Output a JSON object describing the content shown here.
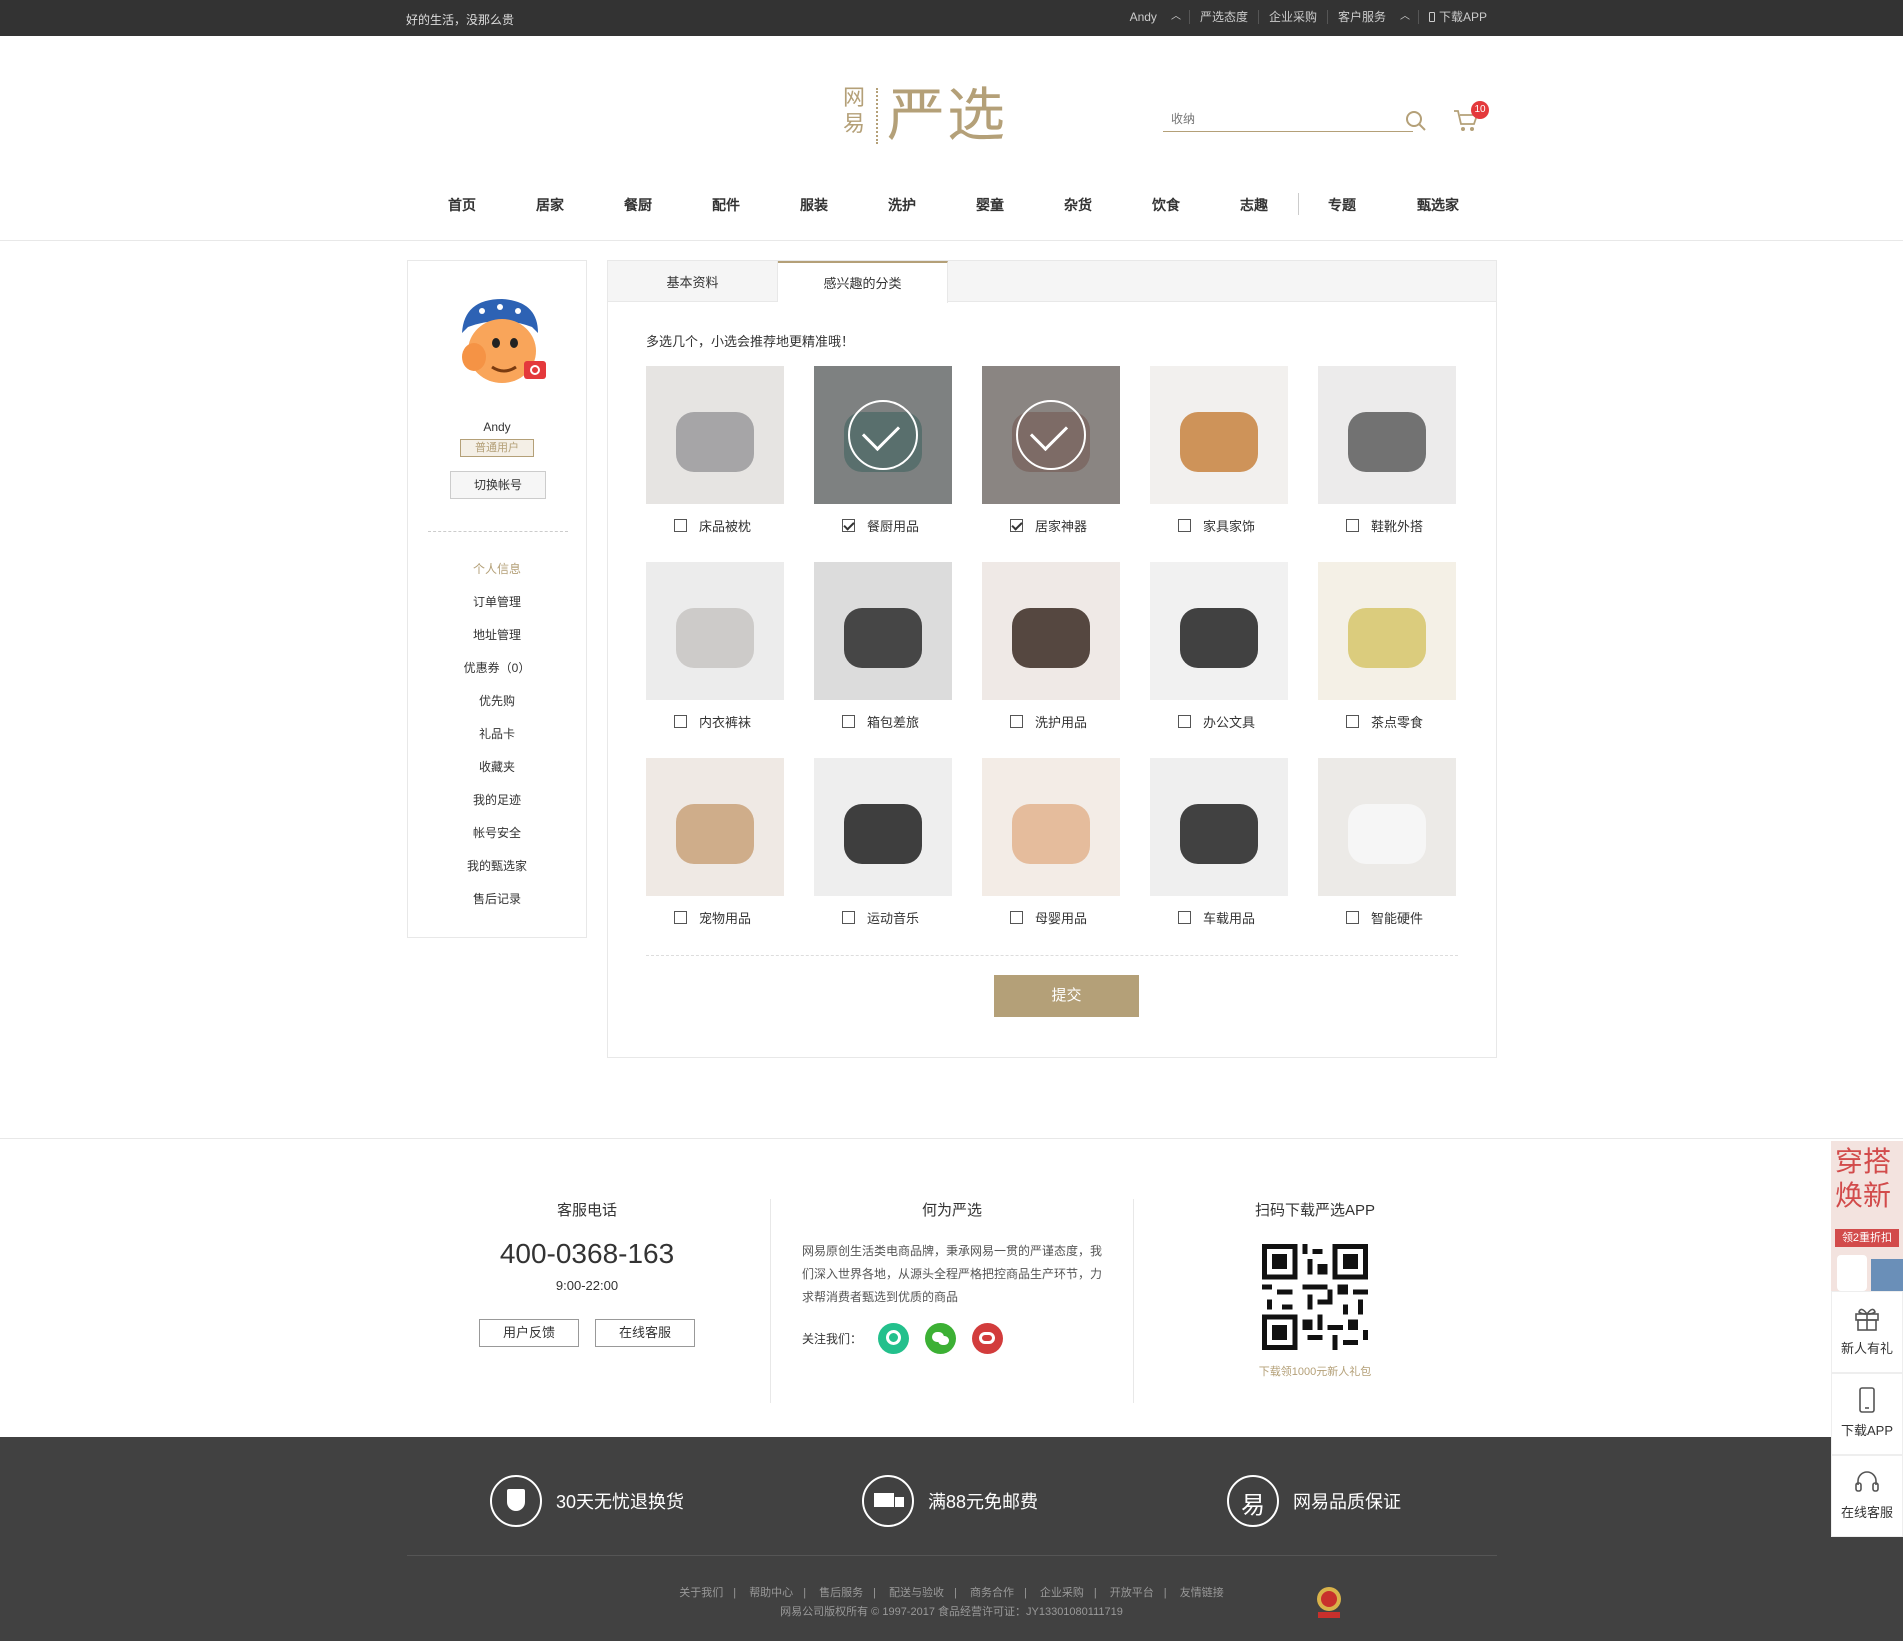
{
  "topbar": {
    "slogan": "好的生活，没那么贵",
    "user": "Andy",
    "links": [
      "严选态度",
      "企业采购",
      "客户服务",
      "下载APP"
    ]
  },
  "header": {
    "logo_small": "网易",
    "logo_big": "严选",
    "search_placeholder": "收纳",
    "cart_count": "10"
  },
  "nav": [
    "首页",
    "居家",
    "餐厨",
    "配件",
    "服装",
    "洗护",
    "婴童",
    "杂货",
    "饮食",
    "志趣",
    "专题",
    "甄选家"
  ],
  "sidebar": {
    "username": "Andy",
    "level": "普通用户",
    "switch_label": "切换帐号",
    "menu": [
      "个人信息",
      "订单管理",
      "地址管理",
      "优惠券（0）",
      "优先购",
      "礼品卡",
      "收藏夹",
      "我的足迹",
      "帐号安全",
      "我的甄选家",
      "售后记录"
    ],
    "active_index": 0
  },
  "tabs": [
    "基本资料",
    "感兴趣的分类"
  ],
  "active_tab": 1,
  "tip": "多选几个，小选会推荐地更精准哦！",
  "categories": [
    {
      "label": "床品被枕",
      "checked": false,
      "icon": "bed-photo"
    },
    {
      "label": "餐厨用品",
      "checked": true,
      "icon": "pot-photo"
    },
    {
      "label": "居家神器",
      "checked": true,
      "icon": "cushion-photo"
    },
    {
      "label": "家具家饰",
      "checked": false,
      "icon": "table-photo"
    },
    {
      "label": "鞋靴外搭",
      "checked": false,
      "icon": "shoes-photo"
    },
    {
      "label": "内衣裤袜",
      "checked": false,
      "icon": "woman-photo"
    },
    {
      "label": "箱包差旅",
      "checked": false,
      "icon": "backpack-photo"
    },
    {
      "label": "洗护用品",
      "checked": false,
      "icon": "makeup-photo"
    },
    {
      "label": "办公文具",
      "checked": false,
      "icon": "pen-photo"
    },
    {
      "label": "茶点零食",
      "checked": false,
      "icon": "tea-photo"
    },
    {
      "label": "宠物用品",
      "checked": false,
      "icon": "dog-photo"
    },
    {
      "label": "运动音乐",
      "checked": false,
      "icon": "sport-photo"
    },
    {
      "label": "母婴用品",
      "checked": false,
      "icon": "baby-photo"
    },
    {
      "label": "车载用品",
      "checked": false,
      "icon": "usb-photo"
    },
    {
      "label": "智能硬件",
      "checked": false,
      "icon": "device-photo"
    }
  ],
  "submit_label": "提交",
  "footer": {
    "service_title": "客服电话",
    "phone": "400-0368-163",
    "hours": "9:00-22:00",
    "feedback_label": "用户反馈",
    "online_label": "在线客服",
    "about_title": "何为严选",
    "about_text": "网易原创生活类电商品牌，秉承网易一贯的严谨态度，我们深入世界各地，从源头全程严格把控商品生产环节，力求帮消费者甄选到优质的商品",
    "follow_label": "关注我们：",
    "app_title": "扫码下载严选APP",
    "app_tip": "下载领1000元新人礼包",
    "pledges": [
      "30天无忧退换货",
      "满88元免邮费",
      "网易品质保证"
    ],
    "links": [
      "关于我们",
      "帮助中心",
      "售后服务",
      "配送与验收",
      "商务合作",
      "企业采购",
      "开放平台",
      "友情链接"
    ],
    "copyright": "网易公司版权所有 © 1997-2017   食品经营许可证：JY13301080111719"
  },
  "float": {
    "promo_text": "穿搭焕新",
    "promo_tag": "领2重折扣",
    "gift_label": "新人有礼",
    "app_label": "下载APP",
    "service_label": "在线客服"
  },
  "colors": {
    "accent": "#b4a078",
    "topbar": "#333333",
    "footer_bottom": "#414141",
    "badge": "#e4393c"
  }
}
